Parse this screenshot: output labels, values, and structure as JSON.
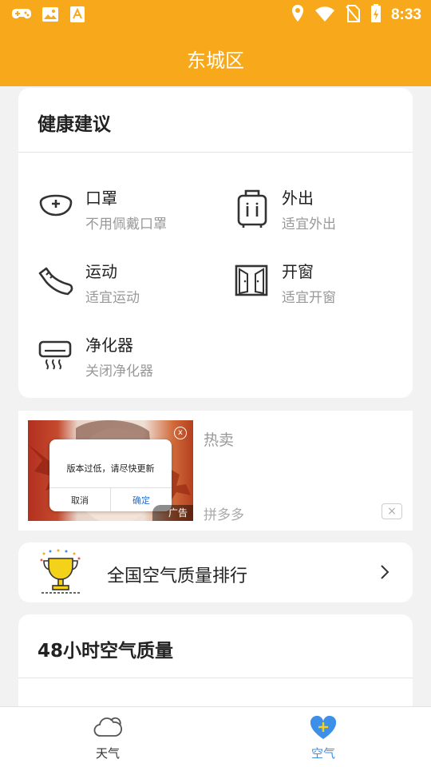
{
  "status_bar": {
    "time": "8:33",
    "left_icons": [
      "game-controller-icon",
      "image-icon",
      "app-store-icon"
    ],
    "right_icons": [
      "location-icon",
      "wifi-icon",
      "no-sim-icon",
      "battery-charging-icon"
    ]
  },
  "header": {
    "title": "东城区"
  },
  "health_card": {
    "title": "健康建议",
    "items": [
      {
        "label": "口罩",
        "status": "不用佩戴口罩",
        "icon": "mask-icon"
      },
      {
        "label": "外出",
        "status": "适宜外出",
        "icon": "luggage-icon"
      },
      {
        "label": "运动",
        "status": "适宜运动",
        "icon": "sneaker-icon"
      },
      {
        "label": "开窗",
        "status": "适宜开窗",
        "icon": "window-icon"
      },
      {
        "label": "净化器",
        "status": "关闭净化器",
        "icon": "air-purifier-icon"
      }
    ]
  },
  "ad": {
    "title": "热卖",
    "brand": "拼多多",
    "badge": "广告",
    "dialog_message": "版本过低，请尽快更新",
    "dialog_cancel": "取消",
    "dialog_ok": "确定",
    "close_glyph": "x",
    "dismiss_glyph": "×"
  },
  "ranking": {
    "label": "全国空气质量排行",
    "icon": "trophy-icon"
  },
  "hourly": {
    "title": "48小时空气质量"
  },
  "tabs": [
    {
      "label": "天气",
      "icon": "cloud-icon",
      "active": false
    },
    {
      "label": "空气",
      "icon": "heart-plus-icon",
      "active": true
    }
  ],
  "colors": {
    "accent": "#f7a91b",
    "tab_active": "#3d8fe8",
    "tab_inactive": "#333333"
  }
}
